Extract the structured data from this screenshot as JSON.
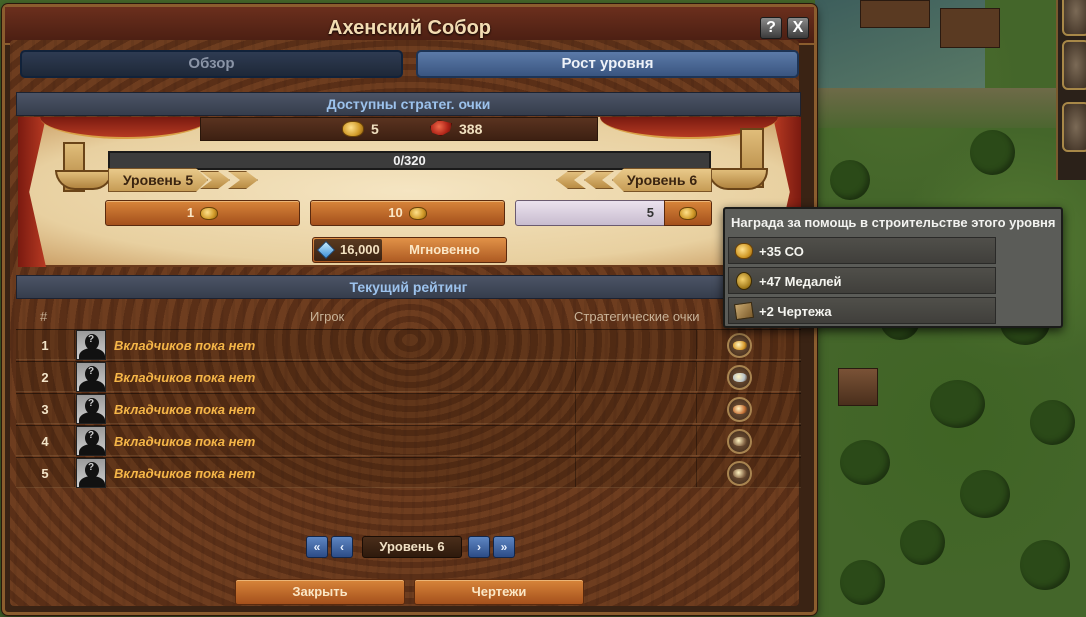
{
  "window": {
    "title": "Ахенский Собор",
    "help_label": "?",
    "close_label": "X"
  },
  "tabs": [
    {
      "label": "Обзор",
      "active": false
    },
    {
      "label": "Рост уровня",
      "active": true
    }
  ],
  "contribution": {
    "header": "Доступны стратег. очки",
    "available_fp": "5",
    "goods": "388",
    "progress_text": "0/320",
    "progress_fraction": 0.0,
    "current_level_label": "Уровень 5",
    "next_level_label": "Уровень 6",
    "pay_one_label": "1",
    "pay_ten_label": "10",
    "amount_value": "5",
    "instant_cost": "16,000",
    "instant_label": "Мгновенно"
  },
  "ranking": {
    "header": "Текущий рейтинг",
    "columns": [
      "#",
      "Игрок",
      "Стратегические очки"
    ],
    "rows": [
      {
        "rank": "1",
        "player": "Вкладчиков пока нет",
        "points": "",
        "reward_color": "#d99a2a"
      },
      {
        "rank": "2",
        "player": "Вкладчиков пока нет",
        "points": "",
        "reward_color": "#b8c2c8"
      },
      {
        "rank": "3",
        "player": "Вкладчиков пока нет",
        "points": "",
        "reward_color": "#c8743a"
      },
      {
        "rank": "4",
        "player": "Вкладчиков пока нет",
        "points": "",
        "reward_color": "#8a6a4a"
      },
      {
        "rank": "5",
        "player": "Вкладчиков пока нет",
        "points": "",
        "reward_color": "#8a6a4a"
      }
    ]
  },
  "pagination": {
    "first_label": "«",
    "prev_label": "‹",
    "level_label": "Уровень 6",
    "next_label": "›",
    "last_label": "»"
  },
  "footer": {
    "close_label": "Закрыть",
    "blueprints_label": "Чертежи"
  },
  "tooltip": {
    "title": "Награда за помощь в строительстве этого уровня",
    "rewards": [
      {
        "icon": "forge-points-icon",
        "text": "+35 СО"
      },
      {
        "icon": "medal-icon",
        "text": "+47 Медалей"
      },
      {
        "icon": "blueprint-icon",
        "text": "+2 Чертежа"
      }
    ]
  }
}
